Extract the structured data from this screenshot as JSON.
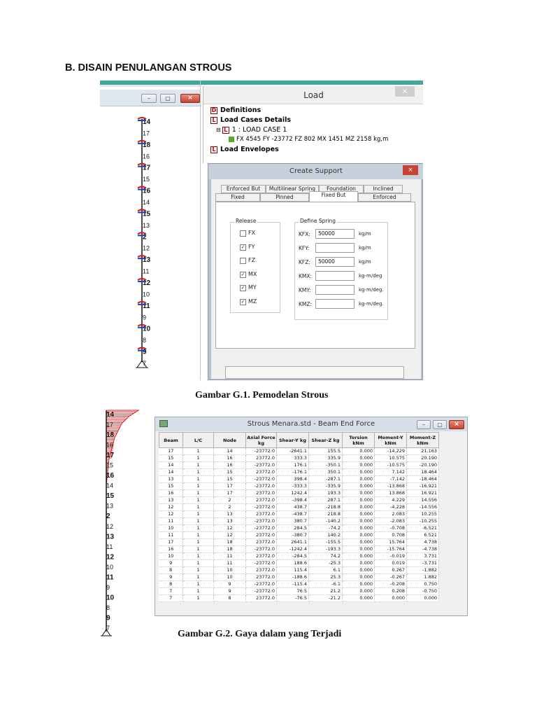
{
  "heading": "B. DISAIN PENULANGAN STROUS",
  "figure1": {
    "left_window": {
      "node_labels": [
        "14",
        "17",
        "18",
        "16",
        "17",
        "15",
        "16",
        "14",
        "15",
        "13",
        "2",
        "12",
        "13",
        "11",
        "12",
        "10",
        "11",
        "9",
        "10",
        "8",
        "9",
        "7"
      ]
    },
    "load_panel": {
      "title": "Load",
      "close": "×",
      "tree": [
        {
          "icon": "D",
          "label": "Definitions",
          "bold": true
        },
        {
          "icon": "L",
          "label": "Load Cases Details",
          "bold": true
        },
        {
          "icon": "L",
          "label": "1 : LOAD CASE 1",
          "bold": false
        },
        {
          "icon": "leaf",
          "label": "FX 4545 FY -23772 FZ 802 MX 1451 MZ 2158 kg,m",
          "bold": false
        },
        {
          "icon": "L",
          "label": "Load Envelopes",
          "bold": true
        }
      ]
    },
    "support_dialog": {
      "title": "Create Support",
      "close": "×",
      "tabs_row1": [
        "Enforced But",
        "Multilinear Spring",
        "Foundation",
        "Inclined"
      ],
      "tabs_row2": [
        "Fixed",
        "Pinned",
        "Fixed But",
        "Enforced"
      ],
      "release_label": "Release",
      "spring_label": "Define Spring",
      "releases": [
        {
          "label": "FX",
          "checked": false
        },
        {
          "label": "FY",
          "checked": true
        },
        {
          "label": "FZ",
          "checked": false
        },
        {
          "label": "MX",
          "checked": true
        },
        {
          "label": "MY",
          "checked": true
        },
        {
          "label": "MZ",
          "checked": true
        }
      ],
      "springs": [
        {
          "label": "KFX:",
          "value": "50000",
          "unit": "kg/m"
        },
        {
          "label": "KFY:",
          "value": "",
          "unit": "kg/m"
        },
        {
          "label": "KFZ:",
          "value": "50000",
          "unit": "kg/m"
        },
        {
          "label": "KMX:",
          "value": "",
          "unit": "kg-m/deg"
        },
        {
          "label": "KMY:",
          "value": "",
          "unit": "kg-m/deg."
        },
        {
          "label": "KMZ:",
          "value": "",
          "unit": "kg-m/deg."
        }
      ]
    },
    "caption": "Gambar G.1. Pemodelan Strous"
  },
  "figure2": {
    "left_labels": [
      "14",
      "17",
      "18",
      "16",
      "17",
      "15",
      "16",
      "14",
      "15",
      "13",
      "2",
      "12",
      "13",
      "11",
      "12",
      "10",
      "11",
      "9",
      "10",
      "8",
      "9",
      "7"
    ],
    "window_title": "Strous Menara.std - Beam End Force",
    "columns": [
      "Beam",
      "L/C",
      "Node",
      "Axial Force kg",
      "Shear-Y kg",
      "Shear-Z kg",
      "Torsion kNm",
      "Moment-Y kNm",
      "Moment-Z kNm"
    ],
    "rows": [
      [
        "17",
        "1",
        "14",
        "-23772.0",
        "-2641.1",
        "155.5",
        "0.000",
        "-14.229",
        "21.163"
      ],
      [
        "15",
        "1",
        "16",
        "23772.0",
        "333.3",
        "335.9",
        "0.000",
        "10.575",
        "20.190"
      ],
      [
        "14",
        "1",
        "16",
        "-23772.0",
        "176.1",
        "-350.1",
        "0.000",
        "-10.575",
        "-20.190"
      ],
      [
        "14",
        "1",
        "15",
        "23772.0",
        "-176.1",
        "350.1",
        "0.000",
        "7.142",
        "18.464"
      ],
      [
        "13",
        "1",
        "15",
        "-23772.0",
        "398.4",
        "-287.1",
        "0.000",
        "-7.142",
        "-18.464"
      ],
      [
        "15",
        "1",
        "17",
        "-23772.0",
        "-333.3",
        "-335.9",
        "0.000",
        "-13.868",
        "-16.921"
      ],
      [
        "16",
        "1",
        "17",
        "23772.0",
        "1242.4",
        "193.3",
        "0.000",
        "13.868",
        "16.921"
      ],
      [
        "13",
        "1",
        "2",
        "23772.0",
        "-398.4",
        "287.1",
        "0.000",
        "4.229",
        "14.556"
      ],
      [
        "12",
        "1",
        "2",
        "-23772.0",
        "438.7",
        "-218.8",
        "0.000",
        "-4.228",
        "-14.556"
      ],
      [
        "12",
        "1",
        "13",
        "23772.0",
        "-438.7",
        "218.8",
        "0.000",
        "2.083",
        "10.255"
      ],
      [
        "11",
        "1",
        "13",
        "-23772.0",
        "380.7",
        "-140.2",
        "0.000",
        "-2.083",
        "-10.255"
      ],
      [
        "10",
        "1",
        "12",
        "-23772.0",
        "284.5",
        "-74.2",
        "0.000",
        "-0.708",
        "-6.521"
      ],
      [
        "11",
        "1",
        "12",
        "23772.0",
        "-380.7",
        "140.2",
        "0.000",
        "0.708",
        "6.521"
      ],
      [
        "17",
        "1",
        "18",
        "23772.0",
        "2641.1",
        "-155.5",
        "0.000",
        "15.764",
        "4.738"
      ],
      [
        "16",
        "1",
        "18",
        "-23772.0",
        "-1242.4",
        "-193.3",
        "0.000",
        "-15.764",
        "-4.738"
      ],
      [
        "10",
        "1",
        "11",
        "23772.0",
        "-284.5",
        "74.2",
        "0.000",
        "-0.019",
        "3.731"
      ],
      [
        "9",
        "1",
        "11",
        "-23772.0",
        "188.6",
        "-25.3",
        "0.000",
        "0.019",
        "-3.731"
      ],
      [
        "8",
        "1",
        "10",
        "23772.0",
        "115.4",
        "6.1",
        "0.000",
        "0.267",
        "-1.882"
      ],
      [
        "9",
        "1",
        "10",
        "23772.0",
        "-188.6",
        "25.3",
        "0.000",
        "-0.267",
        "1.882"
      ],
      [
        "8",
        "1",
        "9",
        "-23772.0",
        "-115.4",
        "-6.1",
        "0.000",
        "-0.208",
        "0.750"
      ],
      [
        "7",
        "1",
        "9",
        "-23772.0",
        "76.5",
        "21.2",
        "0.000",
        "0.208",
        "-0.750"
      ],
      [
        "7",
        "1",
        "8",
        "23772.0",
        "-76.5",
        "-21.2",
        "0.000",
        "0.000",
        "0.000"
      ]
    ],
    "caption": "Gambar G.2. Gaya dalam yang Terjadi"
  }
}
